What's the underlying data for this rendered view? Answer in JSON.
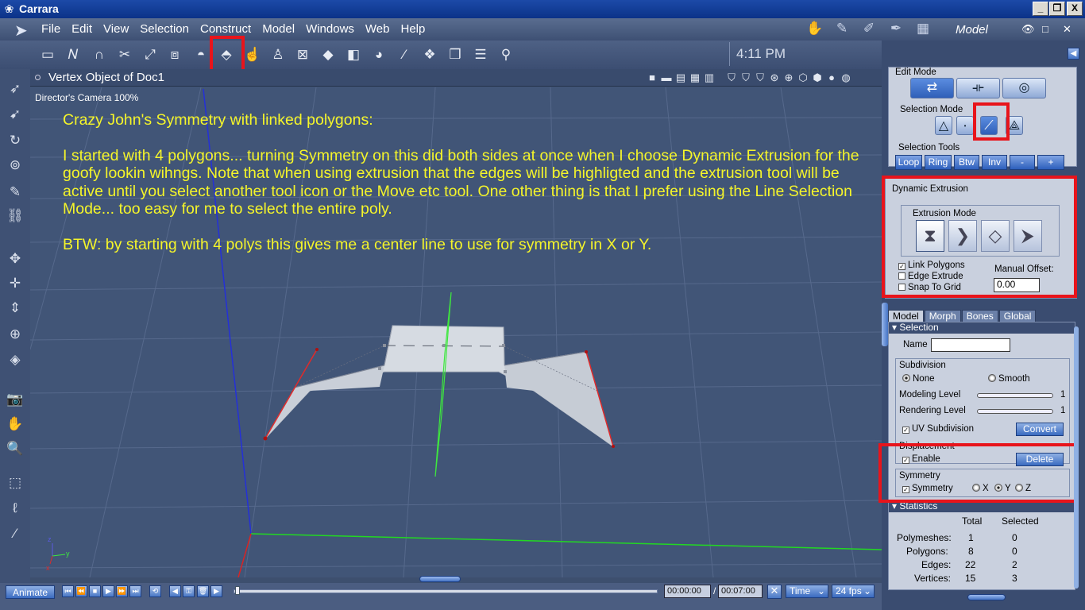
{
  "window": {
    "title": "Carrara",
    "icon": "carrara-logo-icon",
    "min": "_",
    "max": "❐",
    "close": "X"
  },
  "menu": [
    "File",
    "Edit",
    "View",
    "Selection",
    "Construct",
    "Model",
    "Windows",
    "Web",
    "Help"
  ],
  "room": {
    "name": "Model",
    "icons": [
      "assemble-room-icon",
      "model-room-icon",
      "storyboard-room-icon",
      "texture-room-icon",
      "render-room-icon"
    ]
  },
  "toolbar": {
    "clock": "4:11 PM"
  },
  "viewport": {
    "title": "Vertex Object of Doc1",
    "camera": "Director's Camera 100%",
    "note": [
      "Crazy John's Symmetry with linked polygons:",
      "",
      "I started with 4 polygons... turning Symmetry on this did both sides at once when I choose Dynamic Extrusion for the goofy lookin wihngs.  Note that when using extrusion that the edges will be highligted and  the extrusion tool will be active until you select another tool icon or the Move etc tool.  One other thing is that I prefer using the Line Selection Mode... too easy for me to select the entire poly.",
      "",
      "BTW:  by starting with 4 polys this gives me a center line to use for symmetry in X or Y."
    ],
    "axis_labels": {
      "z": "z",
      "x": "x",
      "y": "y"
    }
  },
  "timeline": {
    "animate": "Animate",
    "current_time": "00:00:00",
    "separator": "/",
    "end_time": "00:07:00",
    "time_mode": "Time",
    "fps": "24 fps"
  },
  "panel": {
    "edit_mode": {
      "label": "Edit Mode"
    },
    "selection_mode": {
      "label": "Selection Mode"
    },
    "selection_tools": {
      "label": "Selection Tools",
      "buttons": [
        "Loop",
        "Ring",
        "Btw",
        "Inv",
        "-",
        "+"
      ]
    },
    "dynamic_extrusion": {
      "label": "Dynamic Extrusion",
      "mode_label": "Extrusion Mode",
      "link_polygons": "Link Polygons",
      "edge_extrude": "Edge Extrude",
      "snap_to_grid": "Snap To Grid",
      "manual_offset_label": "Manual Offset:",
      "manual_offset_value": "0.00"
    },
    "tabs": [
      "Model",
      "Morph",
      "Bones",
      "Global"
    ],
    "selection": {
      "header": "Selection",
      "name_label": "Name",
      "name_value": "",
      "subdivision_label": "Subdivision",
      "none": "None",
      "smooth": "Smooth",
      "modeling_level_label": "Modeling Level",
      "modeling_level_value": "1",
      "rendering_level_label": "Rendering Level",
      "rendering_level_value": "1",
      "uv_subdivision": "UV Subdivision",
      "convert": "Convert",
      "displacement_label": "Displacement",
      "enable": "Enable",
      "delete": "Delete",
      "symmetry_label": "Symmetry",
      "symmetry_check": "Symmetry",
      "x": "X",
      "y": "Y",
      "z": "Z"
    },
    "statistics": {
      "header": "Statistics",
      "col_total": "Total",
      "col_selected": "Selected",
      "rows": [
        {
          "label": "Polymeshes:",
          "total": "1",
          "selected": "0"
        },
        {
          "label": "Polygons:",
          "total": "8",
          "selected": "0"
        },
        {
          "label": "Edges:",
          "total": "22",
          "selected": "2"
        },
        {
          "label": "Vertices:",
          "total": "15",
          "selected": "3"
        }
      ]
    }
  }
}
